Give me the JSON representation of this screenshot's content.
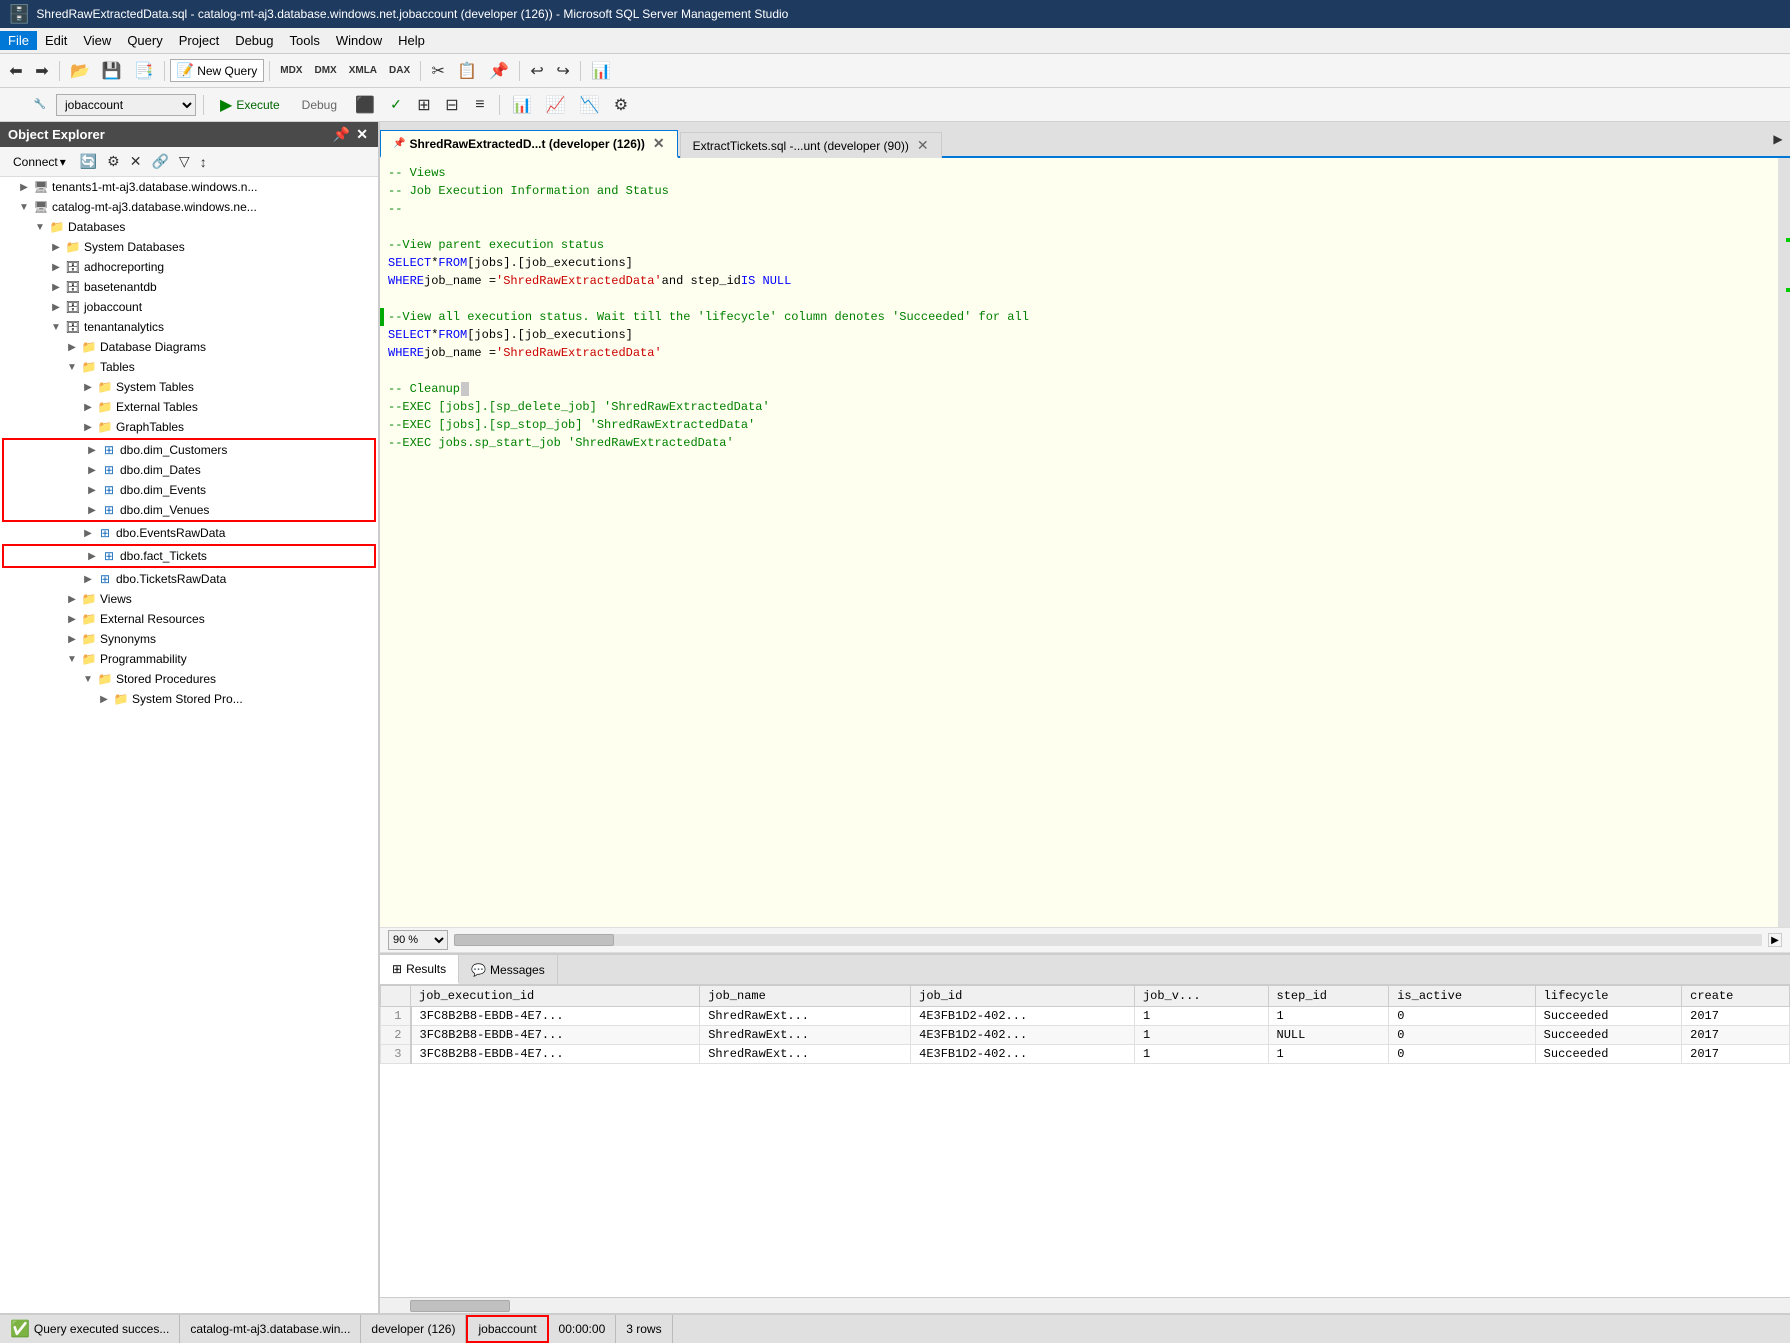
{
  "titleBar": {
    "text": "ShredRawExtractedData.sql - catalog-mt-aj3.database.windows.net.jobaccount (developer (126)) - Microsoft SQL Server Management Studio"
  },
  "menuBar": {
    "items": [
      "File",
      "Edit",
      "View",
      "Query",
      "Project",
      "Debug",
      "Tools",
      "Window",
      "Help"
    ]
  },
  "toolbar1": {
    "newQueryLabel": "New Query"
  },
  "toolbar2": {
    "executeLabel": "Execute",
    "debugLabel": "Debug",
    "database": "jobaccount"
  },
  "objectExplorer": {
    "title": "Object Explorer",
    "connectLabel": "Connect",
    "tree": [
      {
        "id": "server1",
        "label": "tenants1-mt-aj3.database.windows.n...",
        "level": 0,
        "expanded": true,
        "type": "server"
      },
      {
        "id": "server2",
        "label": "catalog-mt-aj3.database.windows.ne...",
        "level": 0,
        "expanded": true,
        "type": "server"
      },
      {
        "id": "databases",
        "label": "Databases",
        "level": 1,
        "expanded": true,
        "type": "folder"
      },
      {
        "id": "sysdb",
        "label": "System Databases",
        "level": 2,
        "expanded": false,
        "type": "folder"
      },
      {
        "id": "adhoc",
        "label": "adhocreporting",
        "level": 2,
        "expanded": false,
        "type": "db"
      },
      {
        "id": "baseten",
        "label": "basetenantdb",
        "level": 2,
        "expanded": false,
        "type": "db"
      },
      {
        "id": "jobaccount",
        "label": "jobaccount",
        "level": 2,
        "expanded": false,
        "type": "db"
      },
      {
        "id": "tenantanalytics",
        "label": "tenantanalytics",
        "level": 2,
        "expanded": true,
        "type": "db"
      },
      {
        "id": "dbdiagrams",
        "label": "Database Diagrams",
        "level": 3,
        "expanded": false,
        "type": "folder"
      },
      {
        "id": "tables",
        "label": "Tables",
        "level": 3,
        "expanded": true,
        "type": "folder"
      },
      {
        "id": "systables",
        "label": "System Tables",
        "level": 4,
        "expanded": false,
        "type": "folder"
      },
      {
        "id": "exttables",
        "label": "External Tables",
        "level": 4,
        "expanded": false,
        "type": "folder"
      },
      {
        "id": "graphtables",
        "label": "GraphTables",
        "level": 4,
        "expanded": false,
        "type": "folder"
      },
      {
        "id": "dimcustomers",
        "label": "dbo.dim_Customers",
        "level": 4,
        "expanded": false,
        "type": "table",
        "redBorder": true
      },
      {
        "id": "dimdates",
        "label": "dbo.dim_Dates",
        "level": 4,
        "expanded": false,
        "type": "table",
        "redBorder": true
      },
      {
        "id": "dimevents",
        "label": "dbo.dim_Events",
        "level": 4,
        "expanded": false,
        "type": "table",
        "redBorder": true
      },
      {
        "id": "dimvenues",
        "label": "dbo.dim_Venues",
        "level": 4,
        "expanded": false,
        "type": "table",
        "redBorder": true
      },
      {
        "id": "eventsraw",
        "label": "dbo.EventsRawData",
        "level": 4,
        "expanded": false,
        "type": "table",
        "redBorder": false
      },
      {
        "id": "facttickets",
        "label": "dbo.fact_Tickets",
        "level": 4,
        "expanded": false,
        "type": "table",
        "redBorder": true
      },
      {
        "id": "ticketsraw",
        "label": "dbo.TicketsRawData",
        "level": 4,
        "expanded": false,
        "type": "table"
      },
      {
        "id": "views",
        "label": "Views",
        "level": 3,
        "expanded": false,
        "type": "folder"
      },
      {
        "id": "extresources",
        "label": "External Resources",
        "level": 3,
        "expanded": false,
        "type": "folder"
      },
      {
        "id": "synonyms",
        "label": "Synonyms",
        "level": 3,
        "expanded": false,
        "type": "folder"
      },
      {
        "id": "programmability",
        "label": "Programmability",
        "level": 3,
        "expanded": true,
        "type": "folder"
      },
      {
        "id": "storedprocs",
        "label": "Stored Procedures",
        "level": 4,
        "expanded": true,
        "type": "folder"
      },
      {
        "id": "sysstoredprocs",
        "label": "System Stored Pro...",
        "level": 5,
        "expanded": false,
        "type": "folder"
      }
    ]
  },
  "tabs": [
    {
      "id": "tab1",
      "label": "ShredRawExtractedD...t (developer (126))",
      "active": true,
      "pinned": true
    },
    {
      "id": "tab2",
      "label": "ExtractTickets.sql -...unt (developer (90))",
      "active": false
    }
  ],
  "codeLines": [
    {
      "content": "-- Views",
      "type": "comment"
    },
    {
      "content": "-- Job Execution Information and Status",
      "type": "comment"
    },
    {
      "content": "--",
      "type": "comment"
    },
    {
      "content": "",
      "type": "normal"
    },
    {
      "content": "--View parent execution status",
      "type": "comment"
    },
    {
      "content": "SELECT * FROM [jobs].[job_executions]",
      "type": "mixed",
      "parts": [
        {
          "text": "SELECT",
          "cls": "c-keyword"
        },
        {
          "text": " * ",
          "cls": "c-normal"
        },
        {
          "text": "FROM",
          "cls": "c-keyword"
        },
        {
          "text": " [jobs].[job_executions]",
          "cls": "c-normal"
        }
      ]
    },
    {
      "content": "WHERE job_name = 'ShredRawExtractedData' and step_id IS NULL",
      "type": "mixed",
      "parts": [
        {
          "text": "WHERE",
          "cls": "c-keyword"
        },
        {
          "text": " job_name = ",
          "cls": "c-normal"
        },
        {
          "text": "'ShredRawExtractedData'",
          "cls": "c-string"
        },
        {
          "text": " and step_id ",
          "cls": "c-normal"
        },
        {
          "text": "IS NULL",
          "cls": "c-keyword"
        }
      ]
    },
    {
      "content": "",
      "type": "normal"
    },
    {
      "content": "--View all execution status. Wait till the 'lifecycle' column denotes 'Succeeded' for all...",
      "type": "comment",
      "greenBar": true
    },
    {
      "content": "SELECT * FROM [jobs].[job_executions]",
      "type": "mixed",
      "parts": [
        {
          "text": "SELECT",
          "cls": "c-keyword"
        },
        {
          "text": " * ",
          "cls": "c-normal"
        },
        {
          "text": "FROM",
          "cls": "c-keyword"
        },
        {
          "text": " [jobs].[job_executions]",
          "cls": "c-normal"
        }
      ]
    },
    {
      "content": "WHERE job_name = 'ShredRawExtractedData'",
      "type": "mixed",
      "parts": [
        {
          "text": "WHERE",
          "cls": "c-keyword"
        },
        {
          "text": " job_name = ",
          "cls": "c-normal"
        },
        {
          "text": "'ShredRawExtractedData'",
          "cls": "c-string"
        }
      ]
    },
    {
      "content": "",
      "type": "normal"
    },
    {
      "content": "-- Cleanup",
      "type": "comment"
    },
    {
      "content": "--EXEC [jobs].[sp_delete_job] 'ShredRawExtractedData'",
      "type": "comment"
    },
    {
      "content": "--EXEC [jobs].[sp_stop_job] 'ShredRawExtractedData'",
      "type": "comment"
    },
    {
      "content": "--EXEC jobs.sp_start_job 'ShredRawExtractedData'",
      "type": "comment"
    }
  ],
  "zoomLevel": "90 %",
  "resultsTabs": [
    {
      "label": "Results",
      "icon": "table-icon",
      "active": true
    },
    {
      "label": "Messages",
      "icon": "messages-icon",
      "active": false
    }
  ],
  "resultsTable": {
    "columns": [
      "job_execution_id",
      "job_name",
      "job_id",
      "job_v...",
      "step_id",
      "is_active",
      "lifecycle",
      "create"
    ],
    "rows": [
      {
        "rowNum": "1",
        "job_execution_id": "3FC8B2B8-EBDB-4E7...",
        "job_name": "ShredRawExt...",
        "job_id": "4E3FB1D2-402...",
        "job_v": "1",
        "step_id": "1",
        "is_active": "0",
        "lifecycle": "Succeeded",
        "create": "2017"
      },
      {
        "rowNum": "2",
        "job_execution_id": "3FC8B2B8-EBDB-4E7...",
        "job_name": "ShredRawExt...",
        "job_id": "4E3FB1D2-402...",
        "job_v": "1",
        "step_id": "NULL",
        "is_active": "0",
        "lifecycle": "Succeeded",
        "create": "2017"
      },
      {
        "rowNum": "3",
        "job_execution_id": "3FC8B2B8-EBDB-4E7...",
        "job_name": "ShredRawExt...",
        "job_id": "4E3FB1D2-402...",
        "job_v": "1",
        "step_id": "1",
        "is_active": "0",
        "lifecycle": "Succeeded",
        "create": "2017"
      }
    ]
  },
  "statusBar": {
    "querySuccess": "Query executed succes...",
    "server": "catalog-mt-aj3.database.win...",
    "user": "developer (126)",
    "database": "jobaccount",
    "time": "00:00:00",
    "rows": "3 rows"
  }
}
